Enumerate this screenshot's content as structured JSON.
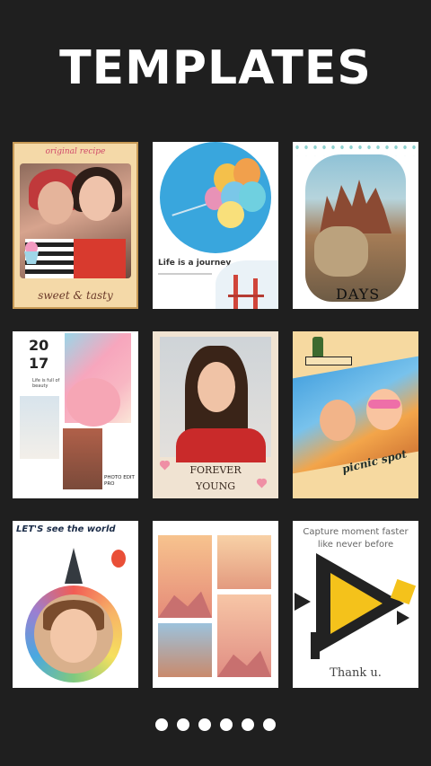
{
  "header": {
    "title": "TEMPLATES"
  },
  "templates": [
    {
      "name": "original-recipe",
      "top_text": "original recipe",
      "bottom_text": "sweet & tasty"
    },
    {
      "name": "life-is-a-journey",
      "text": "Life is a journey"
    },
    {
      "name": "days",
      "text": "DAYS"
    },
    {
      "name": "2017-collage",
      "year_line1": "20",
      "year_line2": "17",
      "small_text": "Life is full of beauty",
      "photo_text": "PHOTO EDIT PRO"
    },
    {
      "name": "forever-young",
      "line1": "FOREVER",
      "line2": "YOUNG"
    },
    {
      "name": "picnic-spot",
      "text": "picnic spot"
    },
    {
      "name": "lets-see-the-world",
      "text": "LET'S see the world"
    },
    {
      "name": "mountain-grid"
    },
    {
      "name": "capture-moment",
      "caption_line1": "Capture moment faster",
      "caption_line2": "like never before",
      "footer": "Thank u."
    }
  ],
  "pagination": {
    "count": 6
  }
}
